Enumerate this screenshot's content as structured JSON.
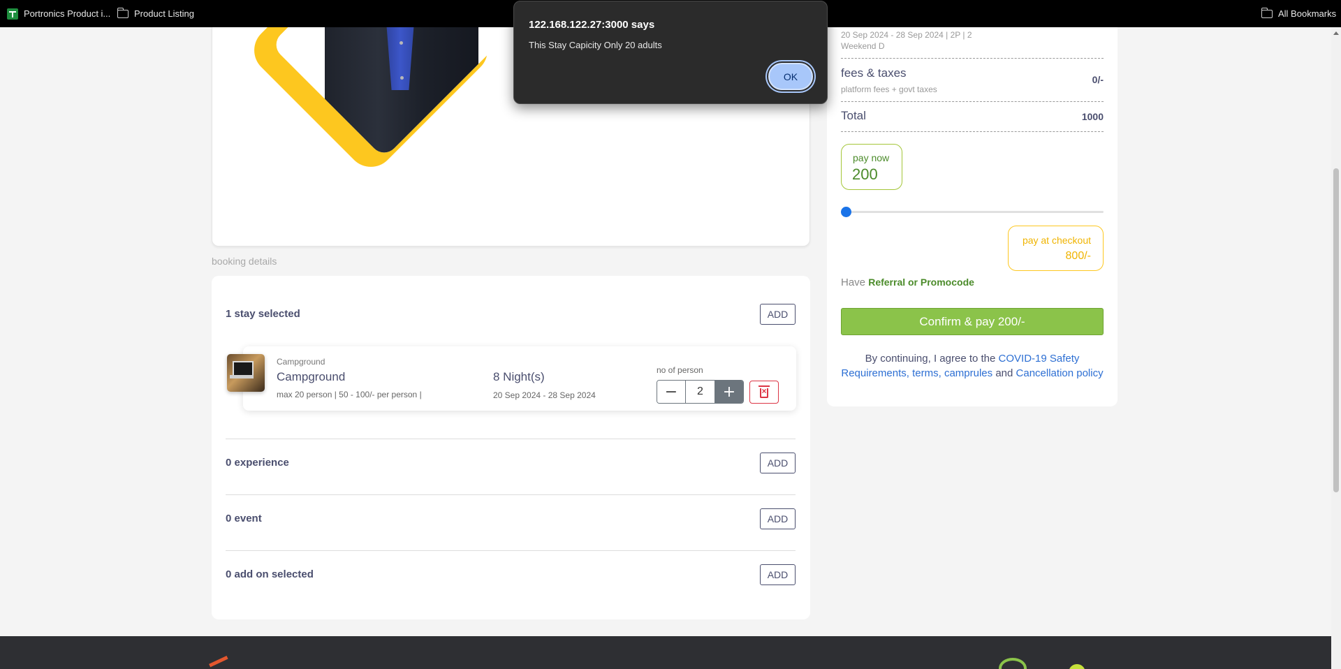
{
  "bookmarks": {
    "items": [
      {
        "label": "Portronics Product i...",
        "icon": "sheet-icon"
      },
      {
        "label": "Product Listing",
        "icon": "folder-icon"
      }
    ],
    "all_bookmarks": "All Bookmarks"
  },
  "alert": {
    "title": "122.168.122.27:3000 says",
    "message": "This Stay Capicity Only 20 adults",
    "ok_label": "OK"
  },
  "booking": {
    "section_label": "booking details",
    "stays": {
      "title": "1 stay selected",
      "add_label": "ADD",
      "item": {
        "category": "Campground",
        "name": "Campground",
        "meta": "max 20 person | 50 - 100/- per person |",
        "nights": "8 Night(s)",
        "dates": "20 Sep 2024 - 28 Sep 2024",
        "person_label": "no of person",
        "person_count": "2",
        "minus": "−",
        "plus": "+"
      }
    },
    "experience": {
      "title": "0 experience",
      "add_label": "ADD"
    },
    "event": {
      "title": "0 event",
      "add_label": "ADD"
    },
    "addon": {
      "title": "0 add on selected",
      "add_label": "ADD"
    }
  },
  "summary": {
    "stay_line": "20 Sep 2024 - 28 Sep 2024 | 2P | 2",
    "stay_sub": "Weekend D",
    "fees_label": "fees & taxes",
    "fees_sub": "platform fees + govt taxes",
    "fees_value": "0/-",
    "total_label": "Total",
    "total_value": "1000",
    "pay_now_label": "pay now",
    "pay_now_value": "200",
    "pay_slider_fraction": 0.0,
    "pay_checkout_label": "pay at checkout",
    "pay_checkout_value": "800/-",
    "promo_prefix": "Have",
    "promo_link": "Referral or Promocode",
    "confirm_label": "Confirm & pay 200/-",
    "agree_prefix": "By continuing, I agree to the",
    "link_covid": "COVID-19 Safety Requirements",
    "link_terms": "terms",
    "link_camprules": "camprules",
    "and": "and",
    "link_cancel": "Cancellation policy"
  },
  "colors": {
    "accent_green": "#8bc34a",
    "accent_yellow": "#fdc71f",
    "link_blue": "#2d6fd3",
    "danger": "#dc3545"
  }
}
